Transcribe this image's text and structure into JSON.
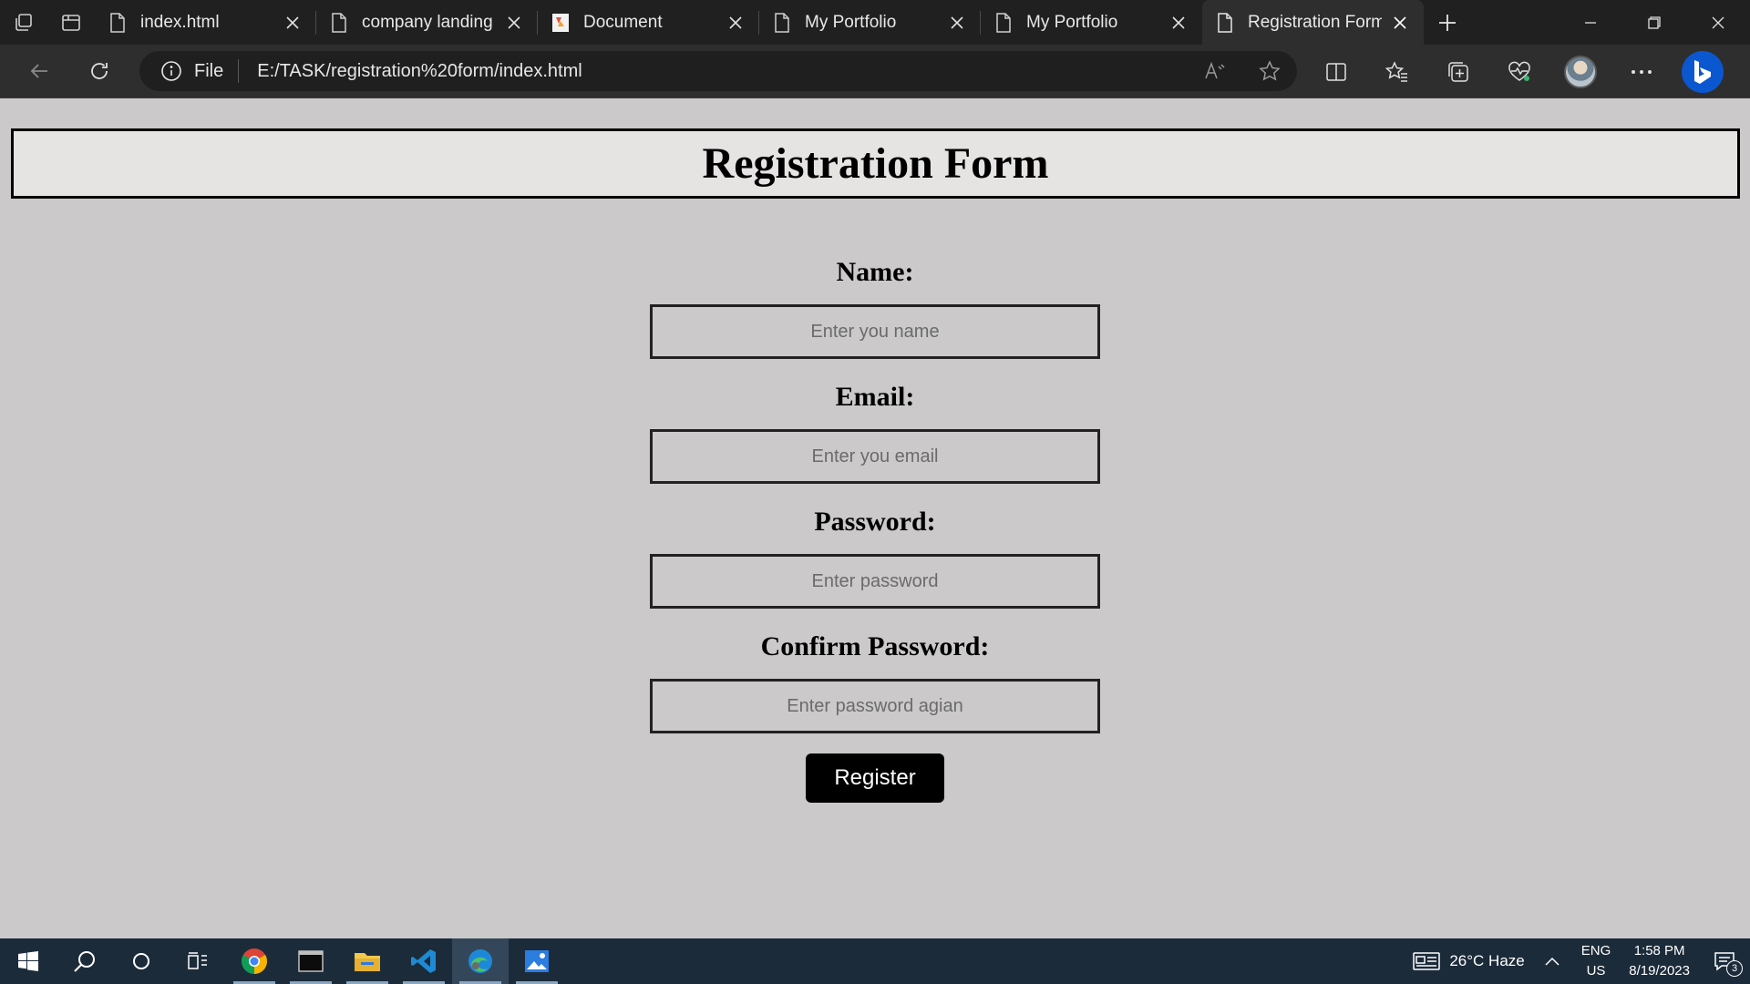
{
  "browser": {
    "tabs": [
      {
        "label": "index.html",
        "icon": "page-icon",
        "active": false
      },
      {
        "label": "company landing",
        "icon": "page-icon",
        "active": false
      },
      {
        "label": "Document",
        "icon": "document-favicon-icon",
        "active": false
      },
      {
        "label": "My Portfolio",
        "icon": "page-icon",
        "active": false
      },
      {
        "label": "My Portfolio",
        "icon": "page-icon",
        "active": false
      },
      {
        "label": "Registration Form",
        "icon": "page-icon",
        "active": true
      }
    ],
    "address": {
      "scheme_label": "File",
      "url": "E:/TASK/registration%20form/index.html"
    }
  },
  "page": {
    "title": "Registration Form",
    "form": {
      "name_label": "Name:",
      "name_placeholder": "Enter you name",
      "email_label": "Email:",
      "email_placeholder": "Enter you email",
      "password_label": "Password:",
      "password_placeholder": "Enter password",
      "confirm_label": "Confirm Password:",
      "confirm_placeholder": "Enter password agian",
      "submit_label": "Register"
    }
  },
  "taskbar": {
    "weather": "26°C  Haze",
    "language_top": "ENG",
    "language_bottom": "US",
    "time": "1:58 PM",
    "date": "8/19/2023",
    "notification_count": "3"
  },
  "colors": {
    "page_background": "#cbc9ca",
    "header_background": "#e6e3e3",
    "button_background": "#000000",
    "titlebar": "#202020",
    "toolbar": "#2e2e2e",
    "taskbar": "#1c2b3a"
  }
}
